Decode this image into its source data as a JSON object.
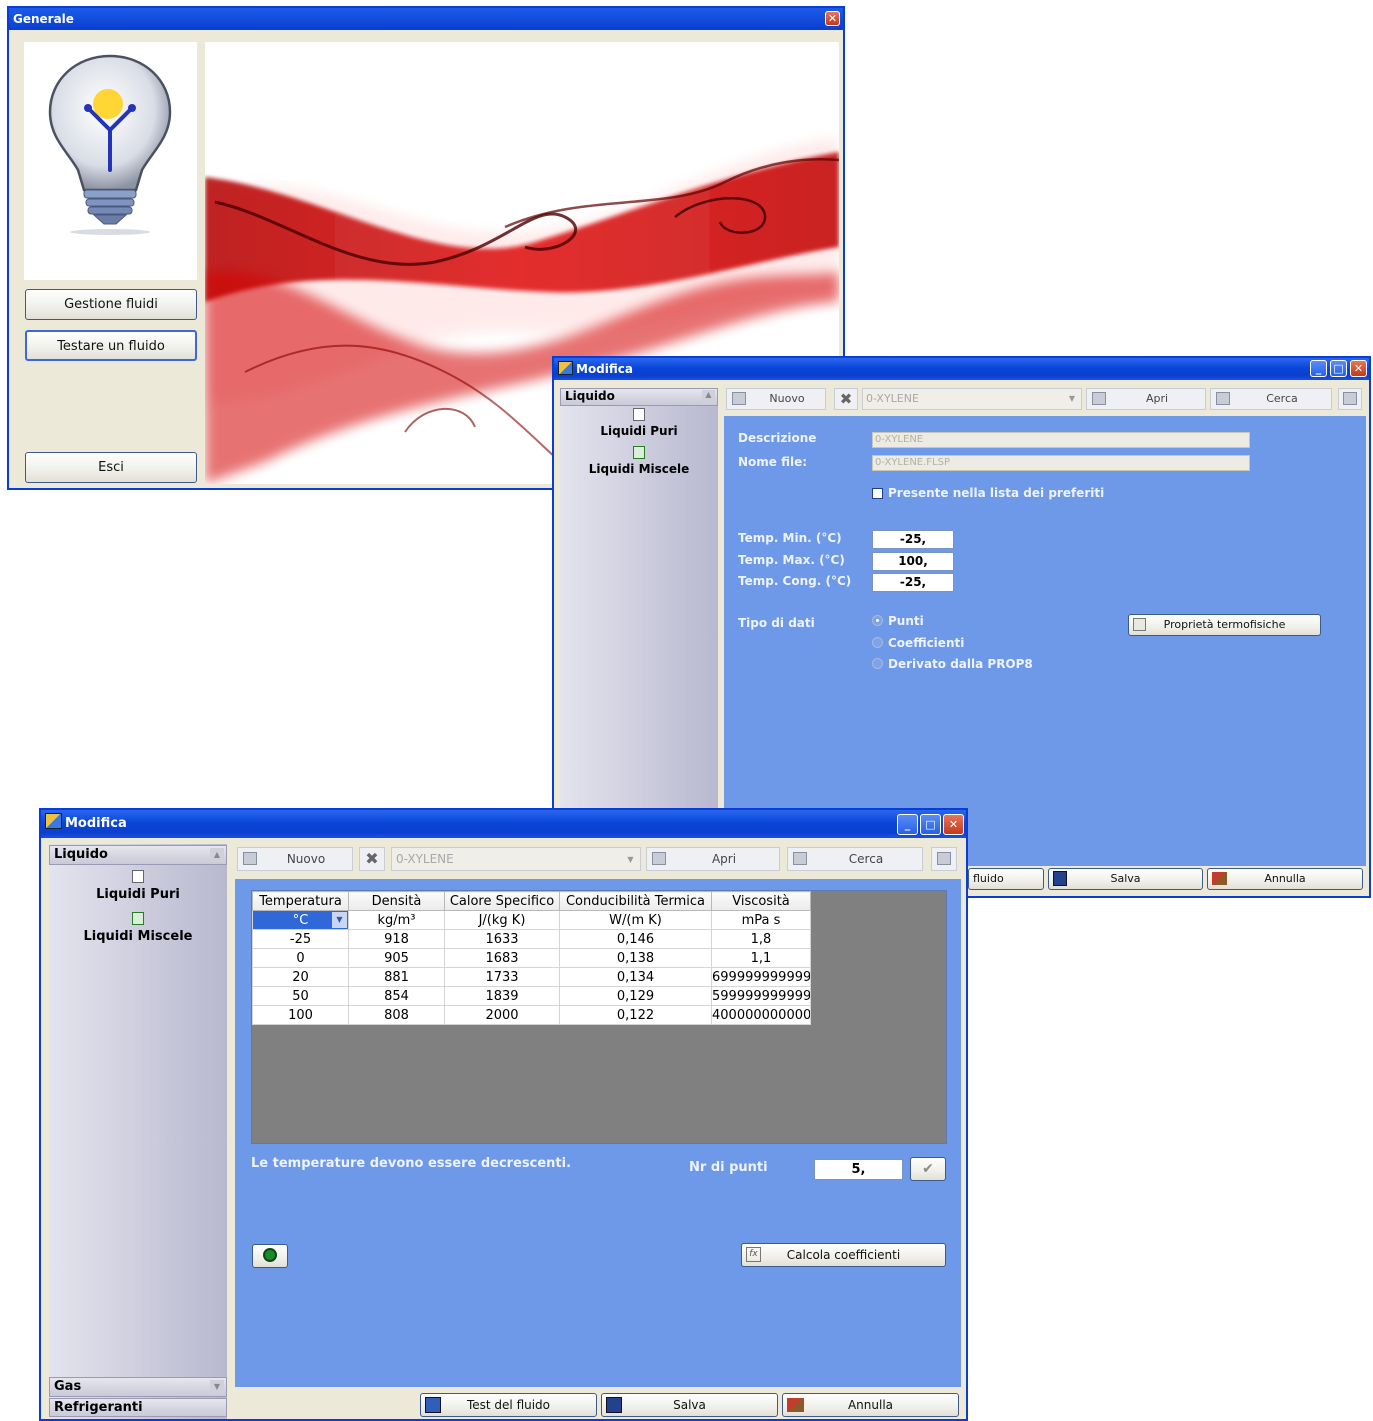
{
  "generale": {
    "title": "Generale",
    "btn_gestione": "Gestione fluidi",
    "btn_testare": "Testare un fluido",
    "btn_esci": "Esci"
  },
  "modifica1": {
    "title": "Modifica",
    "nav_header": "Liquido",
    "nav_items": [
      "Liquidi Puri",
      "Liquidi Miscele"
    ],
    "toolbar": {
      "nuovo": "Nuovo",
      "combo": "0-XYLENE",
      "apri": "Apri",
      "cerca": "Cerca"
    },
    "descrizione_label": "Descrizione",
    "descrizione_value": "0-XYLENE",
    "nomefile_label": "Nome file:",
    "nomefile_value": "0-XYLENE.FLSP",
    "preferiti_label": "Presente nella lista dei preferiti",
    "preferiti_checked": false,
    "tmin_label": "Temp. Min. (°C)",
    "tmin_value": "-25,",
    "tmax_label": "Temp. Max. (°C)",
    "tmax_value": "100,",
    "tcong_label": "Temp. Cong. (°C)",
    "tcong_value": "-25,",
    "tipo_label": "Tipo di dati",
    "tipo_options": [
      "Punti",
      "Coefficienti",
      "Derivato dalla PROP8"
    ],
    "tipo_selected": "Punti",
    "proprieta_button": "Proprietà termofisiche",
    "bottom": {
      "partial": "fluido",
      "salva": "Salva",
      "annulla": "Annulla"
    }
  },
  "modifica2": {
    "title": "Modifica",
    "nav_header": "Liquido",
    "nav_items": [
      "Liquidi Puri",
      "Liquidi Miscele"
    ],
    "nav_footer": [
      "Gas",
      "Refrigeranti"
    ],
    "toolbar": {
      "nuovo": "Nuovo",
      "combo": "0-XYLENE",
      "apri": "Apri",
      "cerca": "Cerca"
    },
    "table": {
      "headers": [
        "Temperatura",
        "Densità",
        "Calore Specifico",
        "Conducibilità Termica",
        "Viscosità"
      ],
      "units": [
        "°C",
        "kg/m³",
        "J/(kg K)",
        "W/(m K)",
        "mPa s"
      ],
      "rows": [
        [
          "-25",
          "918",
          "1633",
          "0,146",
          "1,8"
        ],
        [
          "0",
          "905",
          "1683",
          "0,138",
          "1,1"
        ],
        [
          "20",
          "881",
          "1733",
          "0,134",
          "699999999999"
        ],
        [
          "50",
          "854",
          "1839",
          "0,129",
          "599999999999"
        ],
        [
          "100",
          "808",
          "2000",
          "0,122",
          "400000000000"
        ]
      ]
    },
    "warning": "Le temperature devono essere decrescenti.",
    "nr_punti_label": "Nr di punti",
    "nr_punti_value": "5,",
    "calcola_button": "Calcola coefficienti",
    "bottom": {
      "test": "Test del fluido",
      "salva": "Salva",
      "annulla": "Annulla"
    }
  },
  "icons": [
    "window-icon",
    "lightbulb-icon",
    "smoke-image",
    "document-icon",
    "excel-icon",
    "delete-icon",
    "open-folder-icon",
    "binoculars-icon",
    "export-icon",
    "checkmark-icon",
    "arrow-icon",
    "calculator-icon",
    "save-icon",
    "eraser-icon",
    "fx-icon",
    "properties-icon"
  ]
}
